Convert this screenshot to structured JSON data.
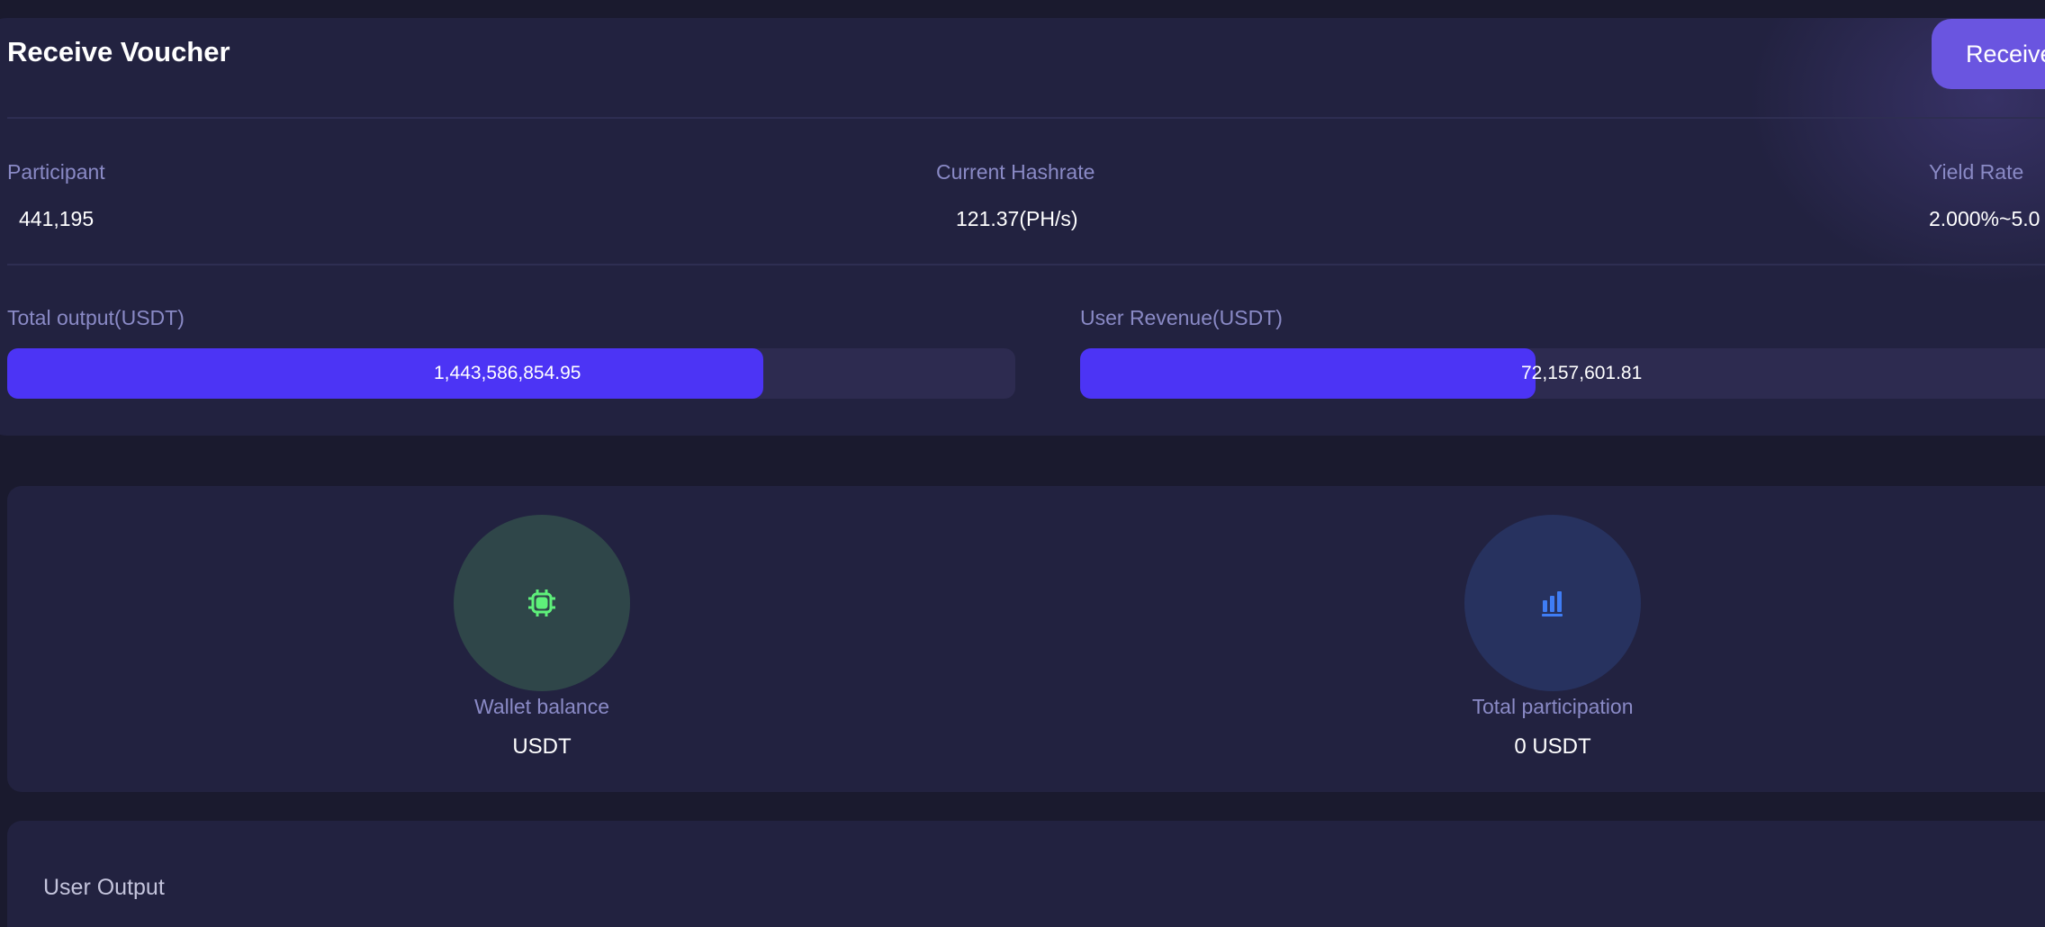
{
  "header": {
    "title": "Receive Voucher",
    "receive_button_label": "Receive"
  },
  "metrics": {
    "participant": {
      "label": "Participant",
      "value": "441,195"
    },
    "hashrate": {
      "label": "Current Hashrate",
      "value": "121.37(PH/s)"
    },
    "yield": {
      "label": "Yield Rate",
      "value": "2.000%~5.0"
    }
  },
  "progress": {
    "total_output": {
      "label": "Total output(USDT)",
      "value": "1,443,586,854.95",
      "fill_fraction": 0.75
    },
    "user_revenue": {
      "label": "User Revenue(USDT)",
      "value": "72,157,601.81",
      "fill_fraction": 0.46
    }
  },
  "stats": {
    "wallet": {
      "icon": "chip-icon",
      "label": "Wallet balance",
      "value": "USDT",
      "icon_color": "#5ef07a",
      "circle_color": "#2f4649"
    },
    "participation": {
      "icon": "bar-chart-icon",
      "label": "Total participation",
      "value": "0 USDT",
      "icon_color": "#3f7df5",
      "circle_color": "#27325f"
    }
  },
  "user_output": {
    "title": "User Output"
  },
  "colors": {
    "background": "#1a1a2e",
    "card": "#222240",
    "accent": "#4c34f5",
    "button": "#6a55e0",
    "label": "#8a8ac6"
  }
}
